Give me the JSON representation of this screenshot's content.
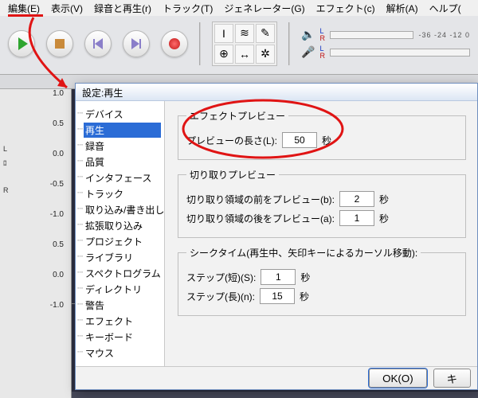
{
  "menu": {
    "items": [
      "編集(E)",
      "表示(V)",
      "録音と再生(r)",
      "トラック(T)",
      "ジェネレーター(G)",
      "エフェクト(c)",
      "解析(A)",
      "ヘルプ("
    ]
  },
  "meter": {
    "l": "L",
    "r": "R",
    "ticks": "-36  -24  -12   0"
  },
  "tools": {
    "ibeam": "I",
    "env": "≋",
    "draw": "✎",
    "zoom": "⊕",
    "shift": "↔",
    "multi": "✲"
  },
  "track": {
    "scale": [
      "1.0",
      "0.5",
      "0.0",
      "-0.5",
      "-1.0",
      "0.5",
      "0.0",
      "-1.0"
    ],
    "ch_l": "L",
    "ch_r": "R",
    "ch_j": "ﾛ"
  },
  "dialog": {
    "title": "設定:再生",
    "tree": [
      "デバイス",
      "再生",
      "録音",
      "品質",
      "インタフェース",
      "トラック",
      "取り込み/書き出し",
      "拡張取り込み",
      "プロジェクト",
      "ライブラリ",
      "スペクトログラム",
      "ディレクトリ",
      "警告",
      "エフェクト",
      "キーボード",
      "マウス"
    ],
    "selected": "再生",
    "g1": {
      "legend": "エフェクトプレビュー",
      "label": "プレビューの長さ(L):",
      "value": "50",
      "unit": "秒"
    },
    "g2": {
      "legend": "切り取りプレビュー",
      "before_label": "切り取り領域の前をプレビュー(b):",
      "before_value": "2",
      "after_label": "切り取り領域の後をプレビュー(a):",
      "after_value": "1",
      "unit": "秒"
    },
    "g3": {
      "legend": "シークタイム(再生中、矢印キーによるカーソル移動):",
      "short_label": "ステップ(短)(S):",
      "short_value": "1",
      "long_label": "ステップ(長)(n):",
      "long_value": "15",
      "unit": "秒"
    },
    "ok": "OK(O)",
    "cancel": "キ"
  }
}
